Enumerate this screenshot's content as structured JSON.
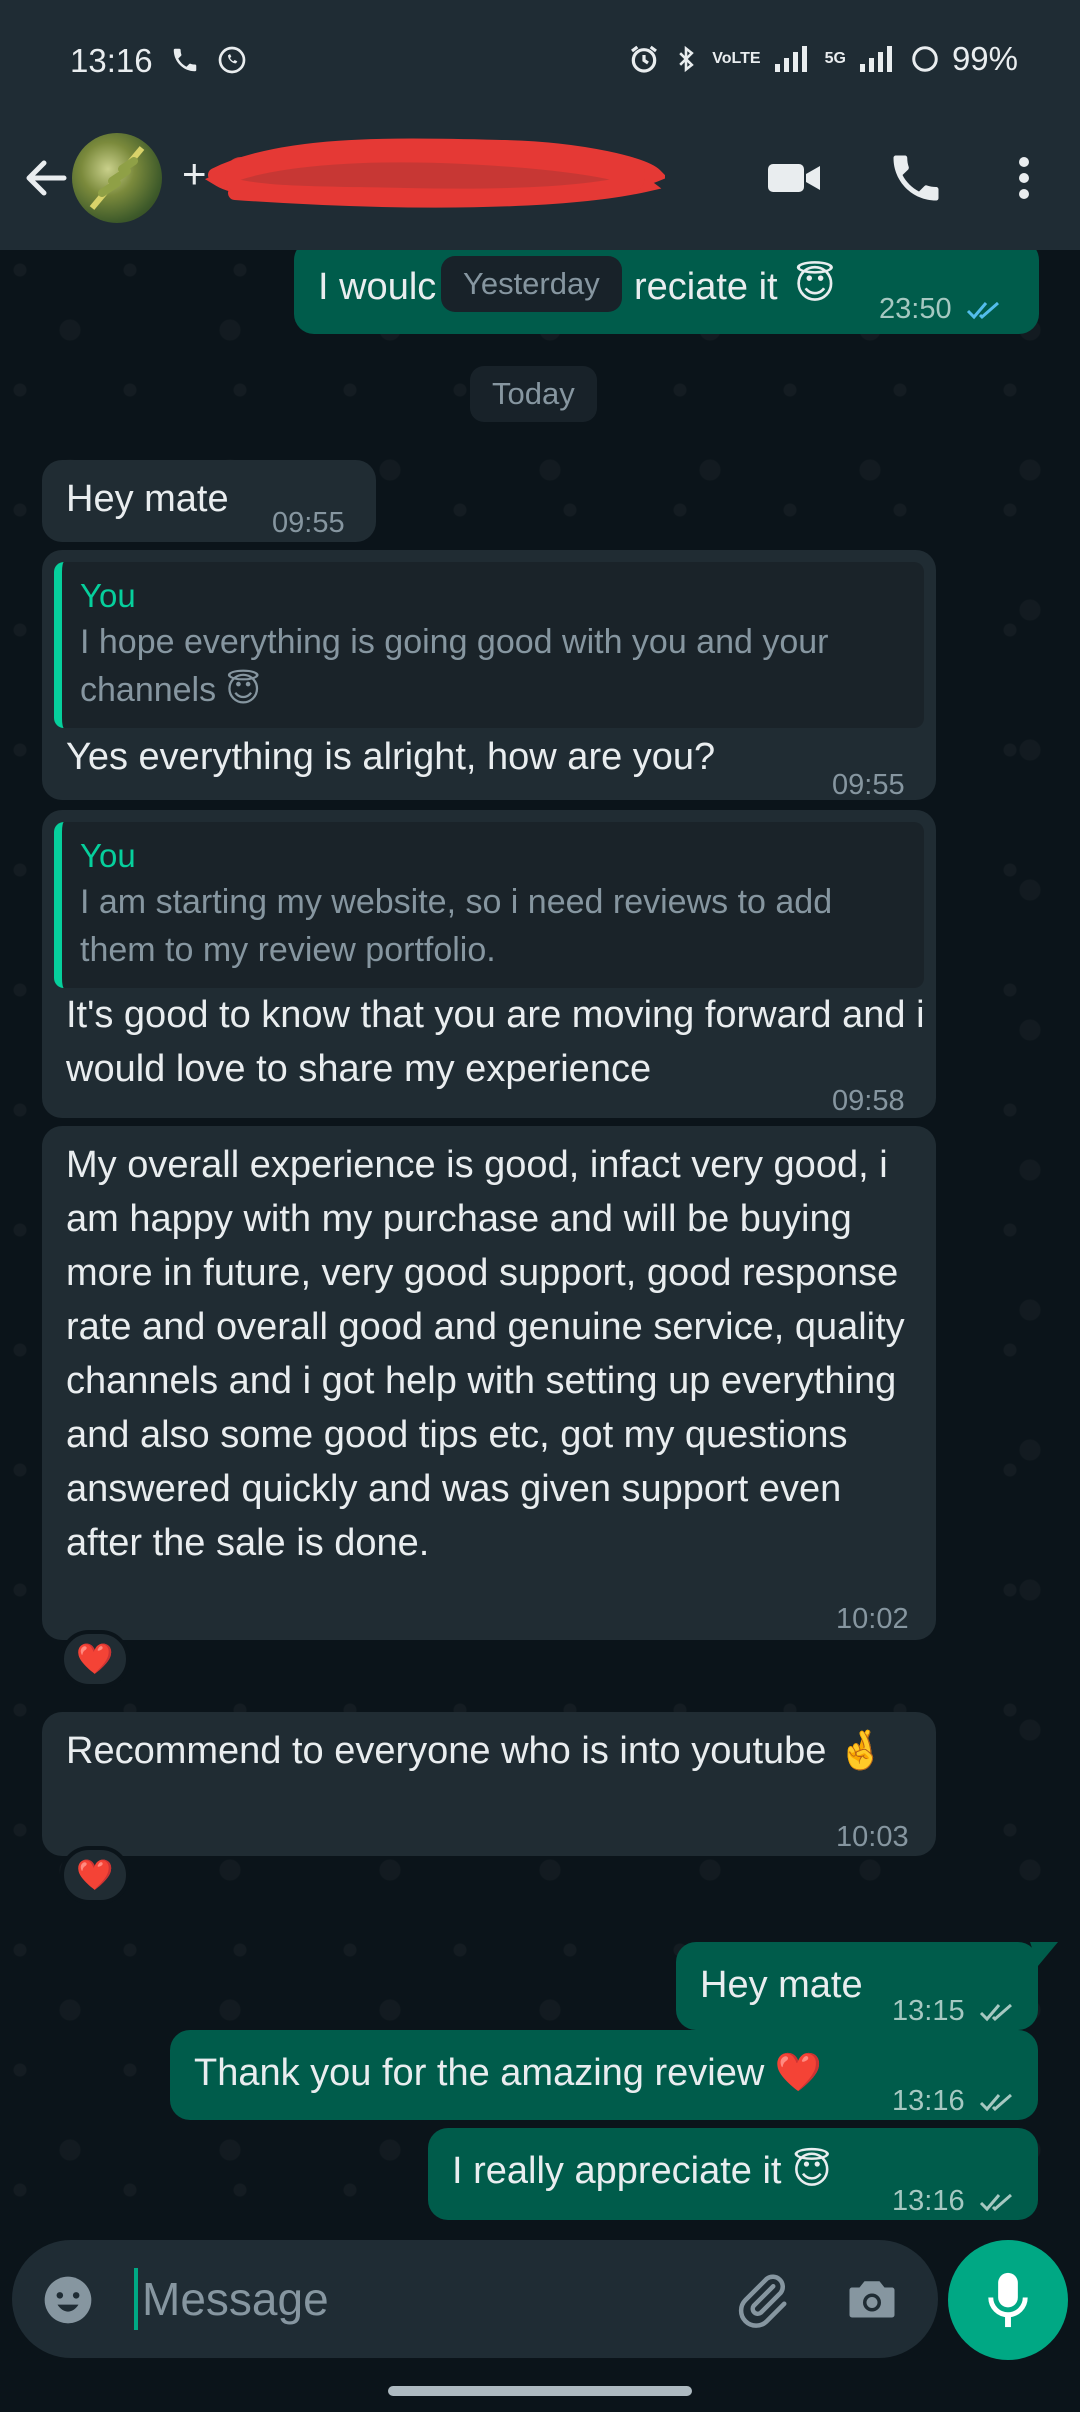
{
  "status_bar": {
    "time": "13:16",
    "battery": "99%",
    "network_small_top": "VoLTE",
    "network_5g": "5G"
  },
  "header": {
    "contact_name_visible": "+",
    "icons": [
      "back-arrow-icon",
      "video-call-icon",
      "phone-icon",
      "more-options-icon"
    ]
  },
  "chat": {
    "top_partial_message": {
      "text_left": "I woulc",
      "text_right": "reciate it",
      "time": "23:50"
    },
    "date_pills": {
      "yesterday": "Yesterday",
      "today": "Today"
    },
    "messages": [
      {
        "text": "Hey mate",
        "time": "09:55"
      },
      {
        "quote_author": "You",
        "quote_text": "I hope everything is going good with you and your channels 😇",
        "text": "Yes everything is alright, how are you?",
        "time": "09:55"
      },
      {
        "quote_author": "You",
        "quote_text": "I am starting my website, so i need reviews to add them to my review portfolio.",
        "text": "It's good to know that you are moving forward and i would love to share my experience",
        "time": "09:58"
      },
      {
        "text": "My overall experience is good, infact very good, i am happy with my purchase and will be buying more in future, very good support, good response rate and overall good and genuine service, quality channels and i got help with setting up everything and also some good tips etc, got my questions answered quickly and was given support even after the sale is done.",
        "time": "10:02",
        "reaction": "❤️"
      },
      {
        "text": "Recommend to everyone who is into youtube 🤞",
        "time": "10:03",
        "reaction": "❤️"
      },
      {
        "text": "Hey mate",
        "time": "13:15"
      },
      {
        "text": "Thank you for the amazing review ❤️",
        "time": "13:16"
      },
      {
        "text": "I really appreciate it 😇",
        "time": "13:16"
      }
    ]
  },
  "input": {
    "placeholder": "Message"
  },
  "colors": {
    "accent": "#00a884",
    "outgoing": "#005c4b",
    "incoming": "#202c33",
    "background": "#0b141a",
    "quote_bar": "#06cf9c",
    "read_tick": "#53bdeb"
  }
}
